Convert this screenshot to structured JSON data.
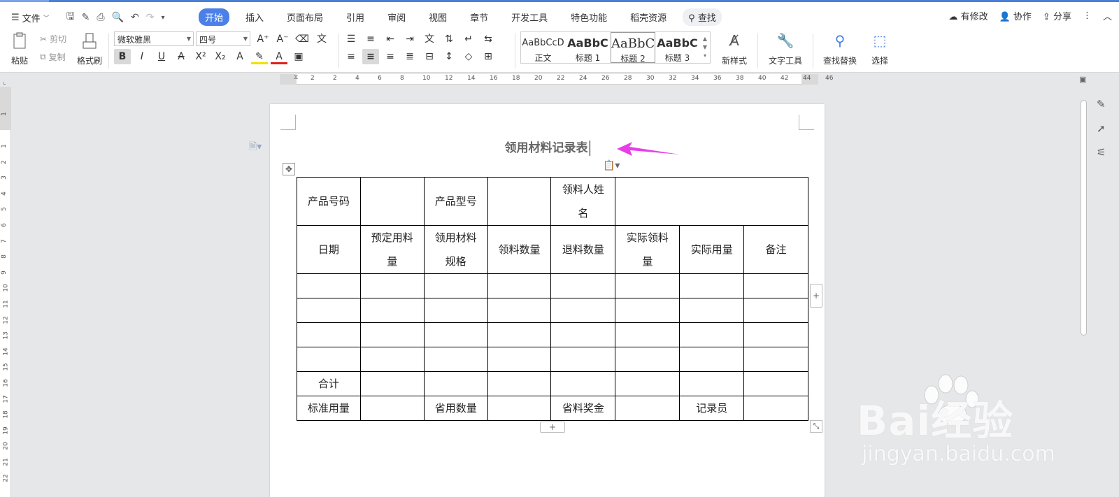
{
  "menu": {
    "file_label": "文件",
    "tabs": [
      "开始",
      "插入",
      "页面布局",
      "引用",
      "审阅",
      "视图",
      "章节",
      "开发工具",
      "特色功能",
      "稻壳资源"
    ],
    "search_label": "查找",
    "right": {
      "modified": "有修改",
      "collab": "协作",
      "share": "分享"
    }
  },
  "ribbon": {
    "paste": "粘贴",
    "cut": "剪切",
    "copy": "复制",
    "format_painter": "格式刷",
    "font_name": "微软雅黑",
    "font_size": "四号",
    "styles": [
      {
        "preview": "AaBbCcD",
        "name": "正文"
      },
      {
        "preview": "AaBbC",
        "name": "标题 1"
      },
      {
        "preview": "AaBbC",
        "name": "标题 2"
      },
      {
        "preview": "AaBbC",
        "name": "标题 3"
      }
    ],
    "new_style": "新样式",
    "text_tools": "文字工具",
    "find_replace": "查找替换",
    "select": "选择"
  },
  "ruler": {
    "h_ticks": [
      "2",
      "2",
      "4",
      "6",
      "8",
      "10",
      "12",
      "14",
      "16",
      "18",
      "20",
      "22",
      "24",
      "26",
      "28",
      "30",
      "32",
      "34",
      "36",
      "38",
      "40",
      "42",
      "44",
      "46"
    ],
    "v_ticks": [
      "1",
      "1",
      "2",
      "3",
      "4",
      "5",
      "6",
      "7",
      "8",
      "9",
      "10",
      "11",
      "12",
      "13",
      "14",
      "15",
      "16",
      "17",
      "18",
      "19",
      "20",
      "21",
      "22"
    ]
  },
  "document": {
    "title": "领用材料记录表",
    "table": {
      "row1": [
        "产品号码",
        "",
        "产品型号",
        "",
        "领料人姓名",
        ""
      ],
      "row2": [
        "日期",
        "预定用料量",
        "领用材料规格",
        "领料数量",
        "退料数量",
        "实际领料量",
        "实际用量",
        "备注"
      ],
      "empty_rows": 4,
      "total_row_label": "合计",
      "last_row": [
        "标准用量",
        "",
        "省用数量",
        "",
        "省料奖金",
        "",
        "记录员",
        ""
      ]
    }
  },
  "watermark": {
    "brand": "Bai经验",
    "url": "jingyan.baidu.com"
  },
  "colors": {
    "accent": "#4a80e8",
    "arrow": "#e83ee8"
  }
}
